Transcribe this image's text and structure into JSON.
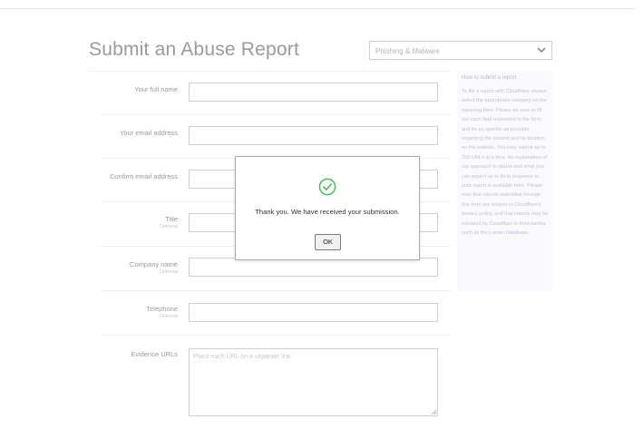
{
  "page": {
    "title": "Submit an Abuse Report"
  },
  "category_select": {
    "value": "Phishing & Malware",
    "icon": "chevron-down-icon"
  },
  "form": {
    "fields": [
      {
        "label": "Your full name",
        "hint": ""
      },
      {
        "label": "Your email address",
        "hint": ""
      },
      {
        "label": "Confirm email address",
        "hint": ""
      },
      {
        "label": "Title",
        "hint": "Optional"
      },
      {
        "label": "Company name",
        "hint": "Optional"
      },
      {
        "label": "Telephone",
        "hint": "Optional"
      },
      {
        "label": "Evidence URLs",
        "hint": "",
        "placeholder": "Place each URL on a separate line"
      }
    ]
  },
  "help": {
    "heading": "How to submit a report",
    "body": "To file a report with Cloudflare, please select the appropriate category on the reporting form. Please be sure to fill out each field requested in the form and be as specific as possible regarding the content and its location on the website. You may submit up to 250 URLs at a time. An explanation of our approach to abuse and what you can expect us to do in response to your report is available here. Please note that reports submitted through this form are subject to Cloudflare's privacy policy, and that reports may be released by Cloudflare to third parties such as the",
    "link_text": "Lumen Database."
  },
  "dialog": {
    "icon": "check-circle-icon",
    "message": "Thank you. We have received your submission.",
    "ok_label": "OK",
    "accent_color": "#4cbb5e"
  }
}
